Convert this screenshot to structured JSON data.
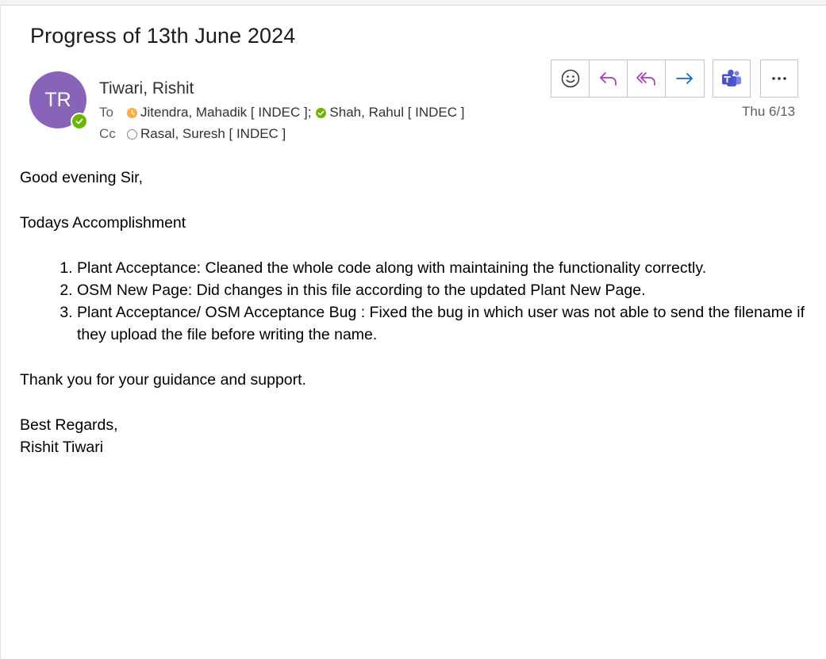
{
  "subject": "Progress of 13th June 2024",
  "sender": {
    "initials": "TR",
    "name": "Tiwari, Rishit",
    "presence": "available"
  },
  "to": {
    "label": "To",
    "recipients": [
      {
        "name": "Jitendra, Mahadik [ INDEC ];",
        "presence": "away"
      },
      {
        "name": "Shah, Rahul [ INDEC ]",
        "presence": "available"
      }
    ]
  },
  "cc": {
    "label": "Cc",
    "recipients": [
      {
        "name": "Rasal, Suresh [ INDEC ]",
        "presence": "offline"
      }
    ]
  },
  "date": "Thu 6/13",
  "toolbar": {
    "icons": [
      "emoji-react-icon",
      "reply-icon",
      "reply-all-icon",
      "forward-icon",
      "teams-icon",
      "more-options-icon"
    ]
  },
  "colors": {
    "avatar": "#8764b8",
    "reply_accent": "#a33db1",
    "forward_accent": "#0f6cbd",
    "teams": "#5059c9",
    "available": "#6bb700",
    "away": "#ffaa44"
  },
  "body": {
    "greeting": "Good evening Sir,",
    "section_title": "Todays Accomplishment",
    "items": [
      "Plant Acceptance: Cleaned the whole code along with maintaining the functionality correctly.",
      "OSM New Page: Did changes in this file according to the updated Plant New Page.",
      "Plant Acceptance/ OSM Acceptance Bug : Fixed the bug in which user was not able to send the filename if they upload the file before writing the name."
    ],
    "thanks": "Thank you for your guidance and support.",
    "signoff": "Best Regards,",
    "signature": "Rishit Tiwari"
  }
}
